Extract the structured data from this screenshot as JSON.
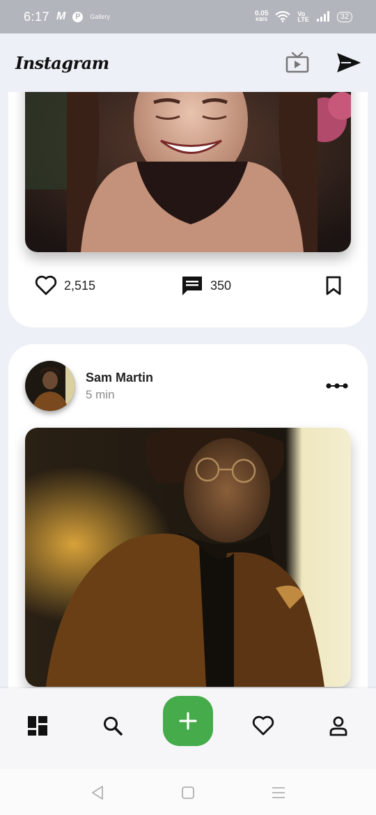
{
  "status_bar": {
    "time": "6:17",
    "icon_m": "M",
    "icon_p": "P",
    "icon_small": "Gallery",
    "speed_value": "0.05",
    "speed_unit": "KB/S",
    "volte_top": "Vo",
    "volte_bottom": "LTE",
    "battery": "32"
  },
  "header": {
    "logo": "Instagram",
    "icons": [
      "igtv-icon",
      "direct-send-icon"
    ]
  },
  "posts": [
    {
      "likes": "2,515",
      "comments": "350"
    },
    {
      "author": "Sam Martin",
      "time": "5 min"
    }
  ],
  "bottom_nav": {
    "items": [
      "dashboard-icon",
      "search-icon",
      "add-icon",
      "heart-icon",
      "profile-icon"
    ],
    "fab_color": "#46ab4a"
  },
  "system_nav": {
    "items": [
      "back-icon",
      "home-icon",
      "menu-icon"
    ]
  }
}
